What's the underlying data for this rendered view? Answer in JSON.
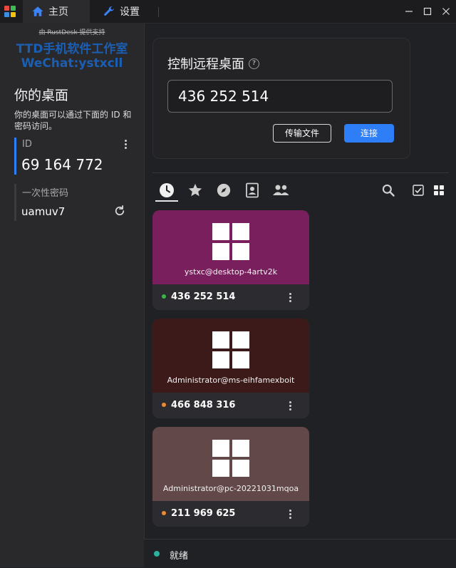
{
  "titlebar": {
    "tabs": [
      {
        "label": "主页",
        "icon": "home-icon",
        "active": true
      },
      {
        "label": "设置",
        "icon": "wrench-icon",
        "active": false
      }
    ]
  },
  "sidebar": {
    "powered_by": "由 RustDesk 提供支持",
    "watermark_line1": "TTD手机软件工作室",
    "watermark_line2": "WeChat:ystxcll",
    "title": "你的桌面",
    "description": "你的桌面可以通过下面的 ID 和密码访问。",
    "id_label": "ID",
    "id_value": "69 164 772",
    "password_label": "一次性密码",
    "password_value": "uamuv7"
  },
  "connect": {
    "title": "控制远程桌面",
    "input_value": "436 252 514",
    "transfer_button": "传输文件",
    "connect_button": "连接"
  },
  "peer_tabs": [
    {
      "icon": "clock-icon",
      "active": true
    },
    {
      "icon": "star-icon",
      "active": false
    },
    {
      "icon": "compass-icon",
      "active": false
    },
    {
      "icon": "address-book-icon",
      "active": false
    },
    {
      "icon": "group-icon",
      "active": false
    }
  ],
  "peers": [
    {
      "name": "ystxc@desktop-4artv2k",
      "id": "436 252 514",
      "color": "#7a1f5e",
      "status_color": "#39b54a"
    },
    {
      "name": "Administrator@ms-eihfamexboit",
      "id": "466 848 316",
      "color": "#3d1a1a",
      "status_color": "#f08a30"
    },
    {
      "name": "Administrator@pc-20221031mqoa",
      "id": "211 969 625",
      "color": "#624848",
      "status_color": "#f08a30"
    }
  ],
  "status": {
    "text": "就绪",
    "color": "#2bb3a0"
  },
  "colors": {
    "accent": "#2d7ef7"
  }
}
